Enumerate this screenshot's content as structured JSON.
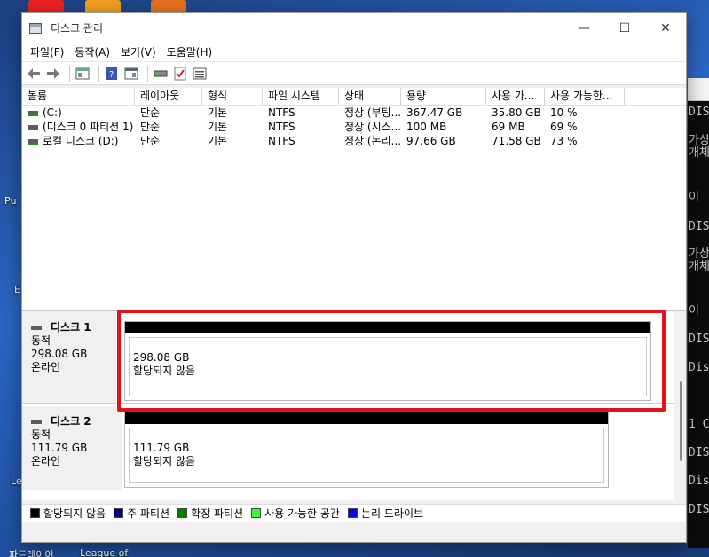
{
  "window": {
    "title": "디스크 관리",
    "min_glyph": "—",
    "max_glyph": "☐",
    "close_glyph": "✕"
  },
  "menu": [
    "파일(F)",
    "동작(A)",
    "보기(V)",
    "도움말(H)"
  ],
  "toolbar_icons": [
    "back-icon",
    "forward-icon",
    "console-tree-icon",
    "help-icon",
    "properties-icon",
    "disk-icon",
    "check-icon",
    "list-icon"
  ],
  "volume_list": {
    "columns": [
      "볼륨",
      "레이아웃",
      "형식",
      "파일 시스템",
      "상태",
      "용량",
      "사용 가...",
      "사용 가능한..."
    ],
    "rows": [
      [
        "(C:)",
        "단순",
        "기본",
        "NTFS",
        "정상 (부팅...",
        "367.47 GB",
        "35.80 GB",
        "10 %"
      ],
      [
        "(디스크 0 파티션 1)",
        "단순",
        "기본",
        "NTFS",
        "정상 (시스...",
        "100 MB",
        "69 MB",
        "69 %"
      ],
      [
        "로컬 디스크 (D:)",
        "단순",
        "기본",
        "NTFS",
        "정상 (논리...",
        "97.66 GB",
        "71.58 GB",
        "73 %"
      ]
    ]
  },
  "disks": [
    {
      "name": "디스크 1",
      "type": "동적",
      "size": "298.08 GB",
      "status": "온라인",
      "partition": {
        "size": "298.08 GB",
        "label": "할당되지 않음"
      }
    },
    {
      "name": "디스크 2",
      "type": "동적",
      "size": "111.79 GB",
      "status": "온라인",
      "partition": {
        "size": "111.79 GB",
        "label": "할당되지 않음"
      }
    }
  ],
  "legend": [
    {
      "label": "할당되지 않음",
      "color": "#000000"
    },
    {
      "label": "주 파티션",
      "color": "#000080"
    },
    {
      "label": "확장 파티션",
      "color": "#008000"
    },
    {
      "label": "사용 가능한 공간",
      "color": "#33ff33"
    },
    {
      "label": "논리 드라이브",
      "color": "#0000ff"
    }
  ],
  "highlight_color": "#e0141c",
  "desktop": {
    "labels": [
      "Pu",
      "E",
      "Le",
      "파트레이어",
      "League of"
    ],
    "console_lines": [
      "DIS",
      "가상",
      "개체",
      "이",
      "DIS",
      "가상",
      "개체",
      "이",
      "DIS",
      "Dis",
      "1 C",
      "DIS",
      "Dis",
      "DIS"
    ]
  }
}
